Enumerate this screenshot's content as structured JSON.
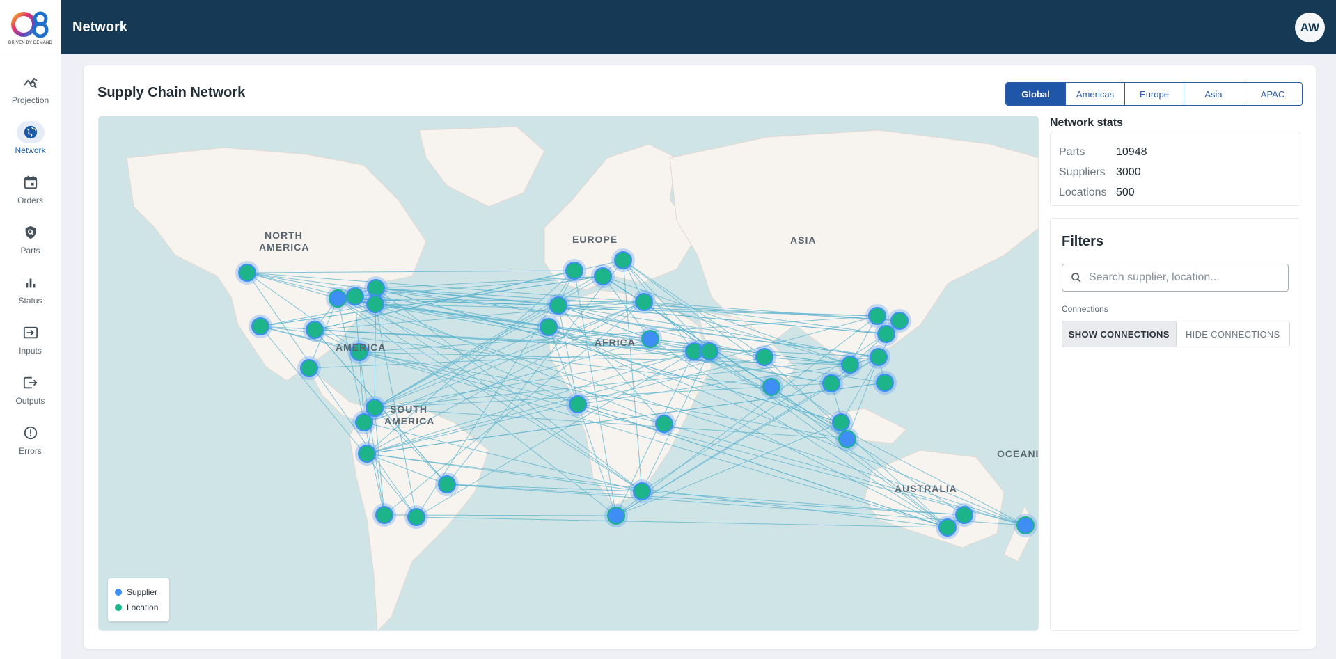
{
  "brand": {
    "logo_text": "O8",
    "tagline": "DRIVEN BY DEMAND"
  },
  "header": {
    "title": "Network",
    "avatar_initials": "AW"
  },
  "sidebar": {
    "items": [
      {
        "label": "Projection",
        "icon": "projection-icon",
        "active": false
      },
      {
        "label": "Network",
        "icon": "globe-icon",
        "active": true
      },
      {
        "label": "Orders",
        "icon": "calendar-icon",
        "active": false
      },
      {
        "label": "Parts",
        "icon": "shield-search-icon",
        "active": false
      },
      {
        "label": "Status",
        "icon": "bar-chart-icon",
        "active": false
      },
      {
        "label": "Inputs",
        "icon": "input-icon",
        "active": false
      },
      {
        "label": "Outputs",
        "icon": "output-icon",
        "active": false
      },
      {
        "label": "Errors",
        "icon": "error-icon",
        "active": false
      }
    ]
  },
  "card": {
    "title": "Supply Chain Network"
  },
  "regions": {
    "items": [
      "Global",
      "Americas",
      "Europe",
      "Asia",
      "APAC"
    ],
    "selected": "Global"
  },
  "map": {
    "labels": [
      "NORTH",
      "AMERICA",
      "EUROPE",
      "ASIA",
      "AMERICA",
      "AFRICA",
      "SOUTH",
      "AMERICA",
      "AUSTRALIA",
      "OCEANI"
    ],
    "legend": {
      "supplier": "Supplier",
      "location": "Location"
    },
    "colors": {
      "supplier": "#3e8ef5",
      "location": "#1db48a",
      "link": "#5bb3cf",
      "water": "#cfe4e6",
      "land": "#f7f3ef"
    }
  },
  "stats": {
    "title": "Network stats",
    "rows": [
      {
        "key": "Parts",
        "value": "10948"
      },
      {
        "key": "Suppliers",
        "value": "3000"
      },
      {
        "key": "Locations",
        "value": "500"
      }
    ]
  },
  "filters": {
    "title": "Filters",
    "search_placeholder": "Search supplier, location...",
    "connections_label": "Connections",
    "show_label": "SHOW CONNECTIONS",
    "hide_label": "HIDE CONNECTIONS"
  },
  "colors": {
    "header_bg": "#163a56",
    "accent": "#1f56a8"
  }
}
